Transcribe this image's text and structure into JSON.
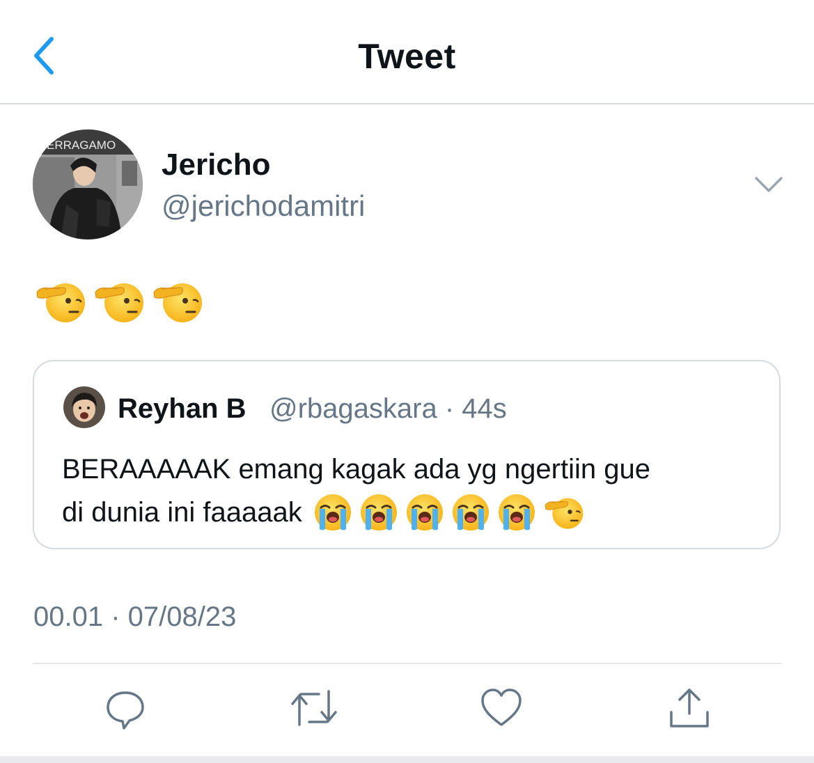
{
  "header": {
    "title": "Tweet",
    "back_icon": "chevron-left-icon"
  },
  "tweet": {
    "author": {
      "name": "Jericho",
      "handle": "@jerichodamitri",
      "avatar_caption": "ERRAGAMO"
    },
    "body_emojis": [
      "saluting-face",
      "saluting-face",
      "saluting-face"
    ],
    "quoted": {
      "author_name": "Reyhan B",
      "handle_and_time": "@rbagaskara · 44s",
      "text_line1": "BERAAAAAK emang kagak ada yg ngertiin gue",
      "text_line2": "di dunia ini faaaaak",
      "trailing_emojis": [
        "loudly-crying-face",
        "loudly-crying-face",
        "loudly-crying-face",
        "loudly-crying-face",
        "loudly-crying-face",
        "saluting-face"
      ]
    },
    "timestamp": "00.01 · 07/08/23",
    "more_icon": "chevron-down-icon"
  },
  "actions": [
    {
      "name": "reply",
      "icon": "speech-bubble-icon"
    },
    {
      "name": "retweet",
      "icon": "retweet-icon"
    },
    {
      "name": "like",
      "icon": "heart-icon"
    },
    {
      "name": "share",
      "icon": "share-icon"
    }
  ],
  "colors": {
    "accent": "#1d9bf0",
    "text": "#0f1419",
    "secondary": "#657786",
    "border": "#d6dbe0"
  }
}
